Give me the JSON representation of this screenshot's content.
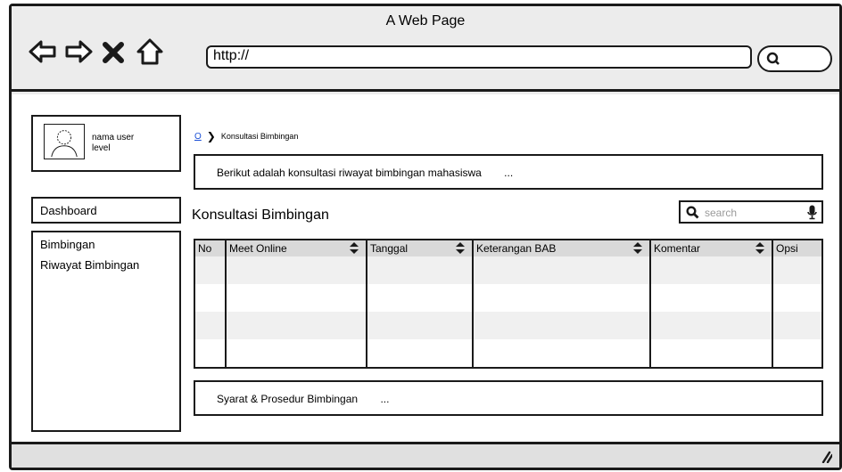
{
  "window": {
    "title": "A Web Page"
  },
  "browser": {
    "url": "http://",
    "nav_icons": [
      "back-arrow-icon",
      "forward-arrow-icon",
      "close-x-icon",
      "home-icon"
    ],
    "search_icon": "search-icon"
  },
  "user": {
    "name": "nama user",
    "level": "level"
  },
  "sidebar": {
    "dashboard_label": "Dashboard",
    "items": [
      {
        "label": "Bimbingan"
      },
      {
        "label": "Riwayat Bimbingan"
      }
    ]
  },
  "breadcrumb": {
    "home": "O",
    "current": "Konsultasi Bimbingan"
  },
  "info_top": {
    "text": "Berikut adalah konsultasi riwayat bimbingan mahasiswa",
    "ellipsis": "..."
  },
  "main": {
    "title": "Konsultasi Bimbingan"
  },
  "search": {
    "placeholder": "search"
  },
  "table": {
    "columns": [
      "No",
      "Meet Online",
      "Tanggal",
      "Keterangan BAB",
      "Komentar",
      "Opsi"
    ],
    "sortable": [
      false,
      true,
      true,
      true,
      true,
      false
    ],
    "rows": [
      [],
      [],
      [],
      []
    ]
  },
  "info_bottom": {
    "text": "Syarat & Prosedur Bimbingan",
    "ellipsis": "..."
  },
  "colors": {
    "link": "#1a4fd6",
    "header_bg": "#d9d9d9",
    "row_alt": "#f0f0f0",
    "chrome": "#ececec"
  }
}
